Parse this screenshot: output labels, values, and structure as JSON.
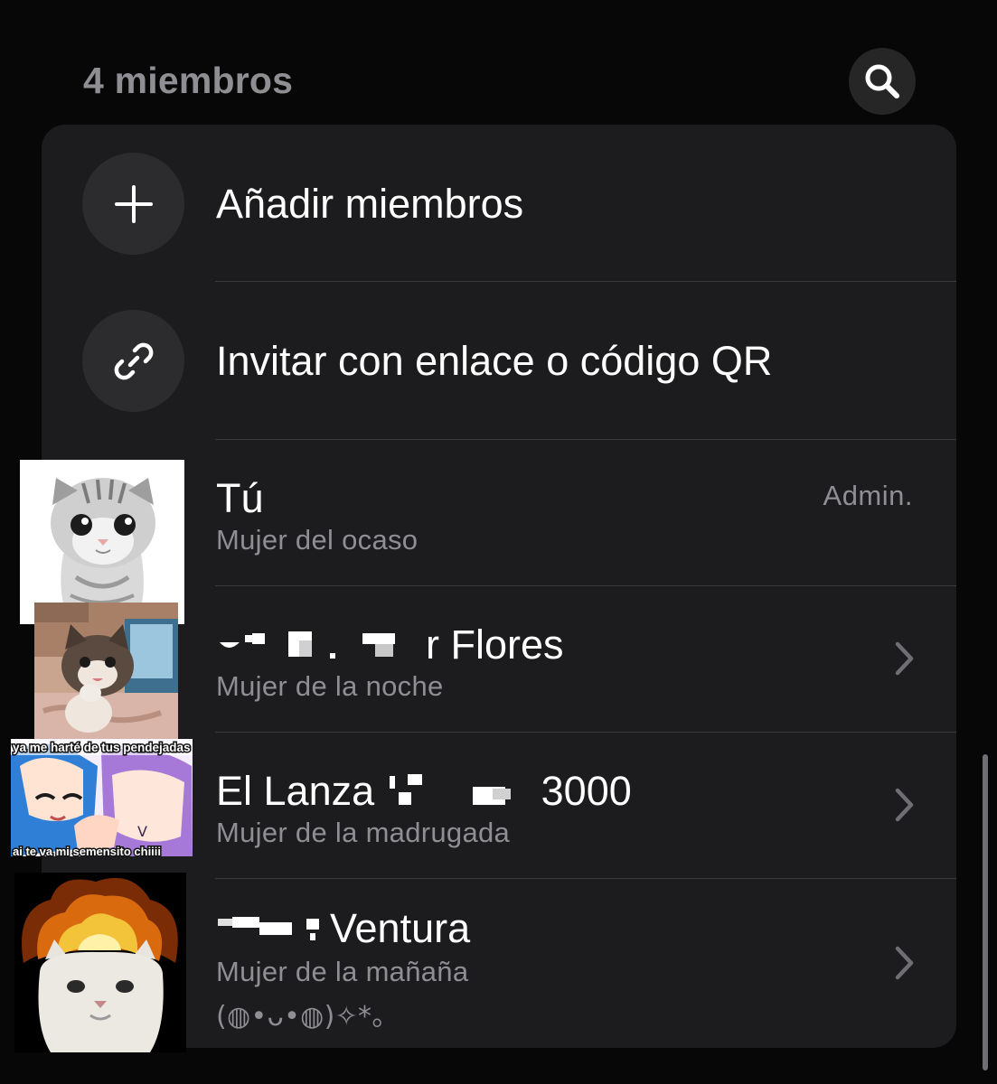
{
  "header": {
    "title": "4 miembros",
    "search_icon": "search-icon"
  },
  "actions": [
    {
      "label": "Añadir miembros",
      "icon": "plus-icon"
    },
    {
      "label": "Invitar con enlace o código QR",
      "icon": "link-icon"
    }
  ],
  "members": [
    {
      "name": "Tú",
      "status": "Mujer del ocaso",
      "role": "Admin.",
      "avatar": "kitten-photo"
    },
    {
      "name_suffix": "r Flores",
      "status": "Mujer de la noche",
      "avatar": "kitten-bed-photo"
    },
    {
      "name_prefix": "El Lanza",
      "name_suffix": "3000",
      "status": "Mujer de la madrugada",
      "avatar": "anime-meme",
      "meme_top": "ya me harté de tus pendejadas",
      "meme_bottom": "ai te va mi semensito chiiii"
    },
    {
      "name_suffix": "Ventura",
      "status": "Mujer de la mañaña",
      "status_extra": "(◍•ᴗ•◍)✧*。",
      "avatar": "fire-cat-photo"
    }
  ],
  "colors": {
    "background": "#070707",
    "card": "#1c1c1e",
    "text": "#ffffff",
    "secondary": "#8e8e93",
    "divider": "#3a3a3c"
  }
}
